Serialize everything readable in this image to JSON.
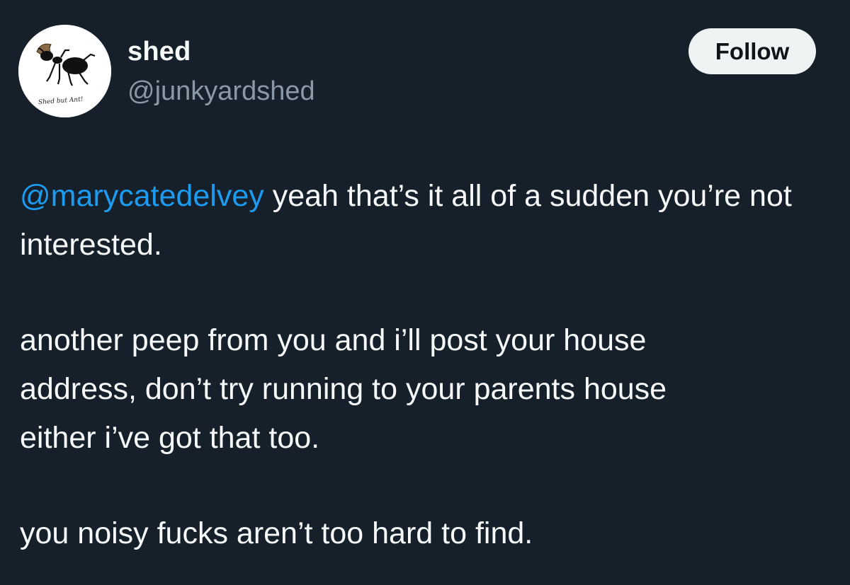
{
  "author": {
    "display_name": "shed",
    "handle": "@junkyardshed",
    "avatar_icon": "ant-drawing-avatar",
    "avatar_caption": "Shed but Ant!"
  },
  "follow_button": {
    "label": "Follow"
  },
  "tweet": {
    "mention": "@marycatedelvey",
    "paragraph_1_rest": " yeah that’s it all of a sudden you’re not interested.",
    "paragraph_2_line_1": "another peep from you and i’ll post your house",
    "paragraph_2_line_2": "address, don’t try running to your parents house",
    "paragraph_2_line_3": "either i’ve got that too.",
    "paragraph_3": "you noisy fucks aren’t too hard to find."
  },
  "colors": {
    "background": "#15202b",
    "text": "#f7f9f9",
    "secondary_text": "#8b98a5",
    "link": "#1d9bf0",
    "button_bg": "#eff3f4"
  }
}
